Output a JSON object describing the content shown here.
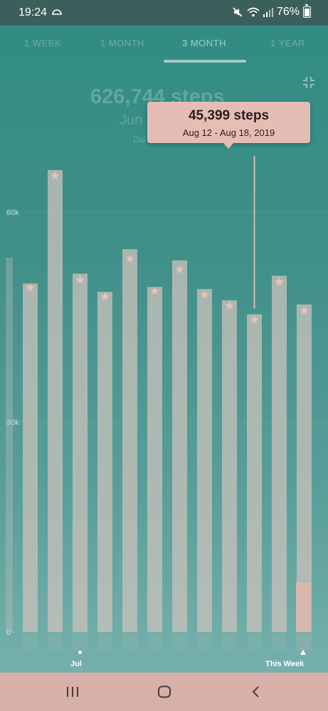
{
  "status_bar": {
    "time": "19:24",
    "battery": "76%",
    "icons": [
      "cloud-icon",
      "mute-icon",
      "wifi-icon",
      "signal-icon",
      "battery-icon"
    ]
  },
  "tabs": [
    {
      "label": "1 WEEK",
      "active": false
    },
    {
      "label": "1 MONTH",
      "active": false
    },
    {
      "label": "3 MONTH",
      "active": true
    },
    {
      "label": "1 YEAR",
      "active": false
    }
  ],
  "summary": {
    "steps": "626,744 steps",
    "range": "Jun",
    "sub": "Dai"
  },
  "tooltip": {
    "steps": "45,399 steps",
    "range": "Aug 12 - Aug 18, 2019"
  },
  "chart_data": {
    "type": "bar",
    "y_ticks": [
      "60k",
      "30k",
      "0"
    ],
    "ylim": [
      0,
      72000
    ],
    "x_labels": [
      "Jul",
      "This Week"
    ],
    "values": [
      49800,
      66000,
      51200,
      48600,
      54700,
      49300,
      53100,
      49000,
      47400,
      45399,
      50900,
      46800,
      7100
    ],
    "goal_star_values": [
      49200,
      65200,
      50300,
      47900,
      53300,
      48700,
      51800,
      48200,
      46600,
      44600,
      50000,
      45900
    ],
    "selected_index": 9,
    "colors": {
      "bar": "#c7c0ba",
      "selected_bar": "#d9b8b2",
      "star": "#e6c3bb",
      "current_week_bar": "#dcb7b0"
    }
  },
  "nav_bar": {
    "icons": [
      "recent-apps-icon",
      "home-icon",
      "back-icon"
    ]
  }
}
